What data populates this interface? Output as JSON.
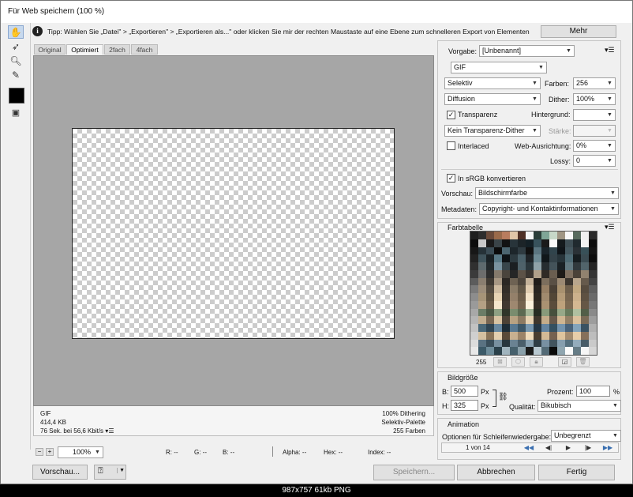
{
  "window": {
    "title": "Für Web speichern (100 %)"
  },
  "tip": {
    "icon": "info-icon",
    "text": "Tipp: Wählen Sie „Datei\" > „Exportieren\" > „Exportieren als...\" oder klicken Sie mir der rechten Maustaste auf eine Ebene zum schnelleren Export von Elementen",
    "more_label": "Mehr"
  },
  "tools": [
    "hand-icon",
    "slice-select-icon",
    "zoom-icon",
    "eyedropper-icon"
  ],
  "tabs": [
    "Original",
    "Optimiert",
    "2fach",
    "4fach"
  ],
  "active_tab": "Optimiert",
  "image_info": {
    "left": [
      "GIF",
      "414,4 KB",
      "76 Sek. bei 56,6 Kbit/s"
    ],
    "right": [
      "100% Dithering",
      "Selektiv-Palette",
      "255 Farben"
    ]
  },
  "status": {
    "zoom": "100%",
    "r": "R: --",
    "g": "G: --",
    "b": "B: --",
    "alpha": "Alpha: --",
    "hex": "Hex: --",
    "index": "Index: --"
  },
  "settings": {
    "preset_label": "Vorgabe:",
    "preset_value": "[Unbenannt]",
    "format": "GIF",
    "reduction": "Selektiv",
    "colors_label": "Farben:",
    "colors": "256",
    "dither_algo": "Diffusion",
    "dither_label": "Dither:",
    "dither": "100%",
    "transparency_label": "Transparenz",
    "transparency": true,
    "matte_label": "Hintergrund:",
    "transp_dither": "Kein Transparenz-Dither",
    "amount_label": "Stärke:",
    "interlaced_label": "Interlaced",
    "interlaced": false,
    "websnap_label": "Web-Ausrichtung:",
    "websnap": "0%",
    "lossy_label": "Lossy:",
    "lossy": "0",
    "srgb_label": "In sRGB konvertieren",
    "srgb": true,
    "preview_label": "Vorschau:",
    "preview": "Bildschirmfarbe",
    "metadata_label": "Metadaten:",
    "metadata": "Copyright- und Kontaktinformationen"
  },
  "color_table": {
    "title": "Farbtabelle",
    "count": "255",
    "colors": [
      "#1e1e1e",
      "#2d2d2d",
      "#6a4a3a",
      "#9a6a4a",
      "#b97c5e",
      "#e0c6a8",
      "#4f3025",
      "#f5f5f5",
      "#2a3d38",
      "#7fa597",
      "#c7d8c8",
      "#a09684",
      "#f7f7f7",
      "#586b5e",
      "#f0f0f0",
      "#2b2b2b",
      "#0c0c0c",
      "#c9c9c9",
      "#1a1a1a",
      "#3a4448",
      "#121212",
      "#28343a",
      "#1c2428",
      "#142026",
      "#38525c",
      "#1a1a1a",
      "#f9f9f9",
      "#141a1d",
      "#3e4e55",
      "#202a2f",
      "#f2f2f2",
      "#0e0e0e",
      "#171717",
      "#263238",
      "#3c4d56",
      "#0b0b0b",
      "#4c6570",
      "#1d262b",
      "#2f3b41",
      "#111",
      "#5b7580",
      "#19242a",
      "#31444c",
      "#0f1418",
      "#44575f",
      "#2a3136",
      "#385058",
      "#151515",
      "#222",
      "#40545c",
      "#1a2226",
      "#5a7a87",
      "#0e1215",
      "#2d3a40",
      "#4a6069",
      "#1f2428",
      "#6e8a94",
      "#10171a",
      "#344249",
      "#27343a",
      "#4e6a74",
      "#161d20",
      "#3b4b52",
      "#0d0d0d",
      "#303030",
      "#5e6a6e",
      "#22292c",
      "#7a93a0",
      "#38454b",
      "#1b1f22",
      "#4f626a",
      "#2b373c",
      "#8fa2a8",
      "#262d30",
      "#44535a",
      "#1a2125",
      "#627880",
      "#31393d",
      "#52646b",
      "#242424",
      "#3b3b3b",
      "#6d6d6d",
      "#2e2e2e",
      "#857a6c",
      "#4a443c",
      "#262626",
      "#5c5247",
      "#3a3530",
      "#b0a08a",
      "#2f2a25",
      "#6a5e50",
      "#1e1b18",
      "#7f7060",
      "#4b4238",
      "#91826f",
      "#353535",
      "#5c5c5c",
      "#8a7e70",
      "#403a33",
      "#a89884",
      "#2b2723",
      "#6e6253",
      "#4e463d",
      "#c4b29a",
      "#1f1c19",
      "#7c6e5d",
      "#5a5045",
      "#9c8a74",
      "#3c362f",
      "#b8a58c",
      "#665a4c",
      "#444",
      "#7a7a7a",
      "#9c8d7a",
      "#544b40",
      "#d0bda2",
      "#332e28",
      "#8a7b67",
      "#625747",
      "#e0ccb0",
      "#282420",
      "#967f64",
      "#4a4035",
      "#a8916f",
      "#6e5f4c",
      "#c2a982",
      "#574c3f",
      "#5f5f5f",
      "#8d8d8d",
      "#a69478",
      "#5e5240",
      "#e8d4b4",
      "#3a332b",
      "#94806a",
      "#6d5d4a",
      "#f2e2c8",
      "#2e2821",
      "#a08a6e",
      "#524636",
      "#b49b78",
      "#786650",
      "#ccb18c",
      "#5e5142",
      "#6a6a6a",
      "#9a9a9a",
      "#b4a084",
      "#6a5b47",
      "#f4e6cc",
      "#403830",
      "#9e8870",
      "#75644f",
      "#fbf1dc",
      "#342d25",
      "#aa9272",
      "#5a4c3b",
      "#bea27c",
      "#7e6b53",
      "#d4b892",
      "#665746",
      "#777",
      "#a8a8a8",
      "#6b7c66",
      "#4a5643",
      "#8ea083",
      "#2e3529",
      "#7a8c6e",
      "#5c6a52",
      "#a5b698",
      "#262c22",
      "#889a7a",
      "#46503d",
      "#97a888",
      "#687a5c",
      "#b0c0a0",
      "#525e48",
      "#8a8a8a",
      "#b5b5b5",
      "#c2ae90",
      "#786652",
      "#d8c4a4",
      "#4c4236",
      "#b8a282",
      "#8c7a62",
      "#e6d2b2",
      "#3e362c",
      "#c4ac8a",
      "#66584a",
      "#d0b692",
      "#948066",
      "#dcc29e",
      "#7a6a56",
      "#9d9d9d",
      "#c2c2c2",
      "#4a6878",
      "#2e4452",
      "#6888a0",
      "#1c2c36",
      "#587890",
      "#3c5666",
      "#7898b0",
      "#243644",
      "#6484a0",
      "#345060",
      "#7494ae",
      "#48627a",
      "#84a4bc",
      "#3a5262",
      "#b0b0b0",
      "#cfcfcf",
      "#d4c0a0",
      "#8a7458",
      "#e4d0b0",
      "#5a4a38",
      "#c8b090",
      "#9c8468",
      "#f0dcbc",
      "#4a3e30",
      "#d4ba96",
      "#766250",
      "#dec49e",
      "#a48c70",
      "#e8ceaa",
      "#86705a",
      "#bdbdbd",
      "#dcdcdc",
      "#5a7282",
      "#3a4e5a",
      "#7890a0",
      "#28363e",
      "#6a8292",
      "#4a5e6a",
      "#8aa2b2",
      "#303e46",
      "#7890a2",
      "#42545e",
      "#869eae",
      "#56707e",
      "#94acbc",
      "#485c68",
      "#cacaca",
      "#e8e8e8",
      "#3c5a68",
      "#6e8c9a",
      "#2a404a",
      "#a0b4be",
      "#46606c",
      "#8aa0aa",
      "#1a1a1a",
      "#b8c8d0",
      "#536a76",
      "#0a0a0a",
      "#90a6b0",
      "#fbfbfb",
      "#667c86",
      "#f6f6f6",
      "#d6d6d6"
    ]
  },
  "image_size": {
    "title": "Bildgröße",
    "w_label": "B:",
    "w": "500",
    "h_label": "H:",
    "h": "325",
    "unit": "Px",
    "percent_label": "Prozent:",
    "percent": "100",
    "percent_unit": "%",
    "quality_label": "Qualität:",
    "quality": "Bikubisch"
  },
  "animation": {
    "title": "Animation",
    "loop_label": "Optionen für Schleifenwiedergabe:",
    "loop": "Unbegrenzt",
    "frame": "1 von 14"
  },
  "buttons": {
    "preview": "Vorschau...",
    "save": "Speichern...",
    "cancel": "Abbrechen",
    "done": "Fertig"
  },
  "caption": "987x757  61kb  PNG",
  "colors": {
    "accent": "#3a6fb0",
    "selected_tool": "#c7d9ee"
  }
}
